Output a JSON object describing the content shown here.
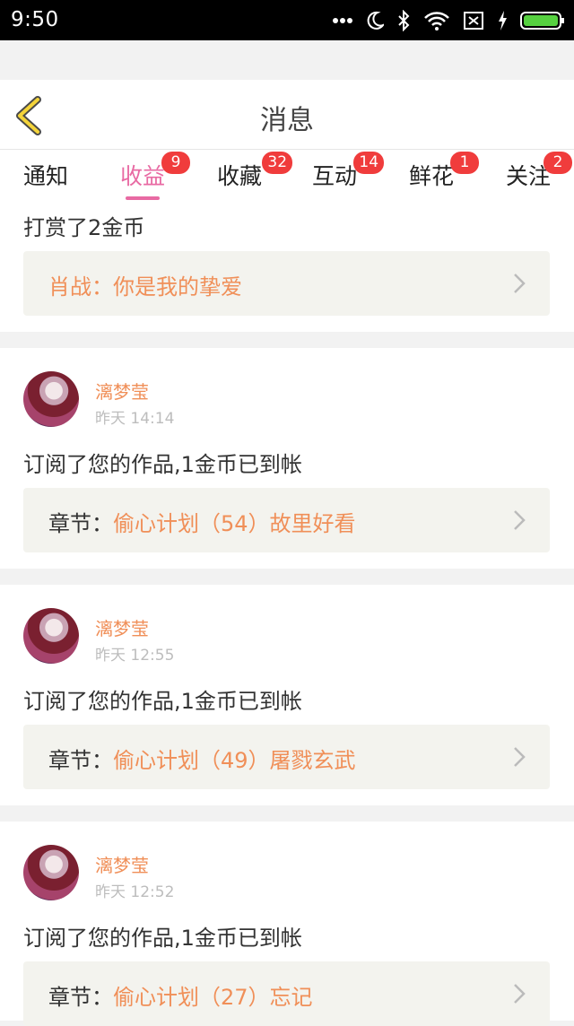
{
  "status_bar": {
    "time": "9:50"
  },
  "header": {
    "title": "消息"
  },
  "tabs": [
    {
      "label": "通知",
      "badge": ""
    },
    {
      "label": "收益",
      "badge": "9",
      "active": true
    },
    {
      "label": "收藏",
      "badge": "32"
    },
    {
      "label": "互动",
      "badge": "14"
    },
    {
      "label": "鲜花",
      "badge": "1"
    },
    {
      "label": "关注",
      "badge": "2"
    }
  ],
  "partial_item": {
    "text": "打赏了2金币",
    "link_label": "肖战：",
    "link_value": "你是我的挚爱"
  },
  "items": [
    {
      "user": "漓梦莹",
      "time": "昨天 14:14",
      "text": "订阅了您的作品,1金币已到帐",
      "link_label": "章节：",
      "link_value": "偷心计划（54）故里好看"
    },
    {
      "user": "漓梦莹",
      "time": "昨天 12:55",
      "text": "订阅了您的作品,1金币已到帐",
      "link_label": "章节：",
      "link_value": "偷心计划（49）屠戮玄武"
    },
    {
      "user": "漓梦莹",
      "time": "昨天 12:52",
      "text": "订阅了您的作品,1金币已到帐",
      "link_label": "章节：",
      "link_value": "偷心计划（27）忘记"
    }
  ],
  "colors": {
    "accent_pink": "#e86aa3",
    "accent_orange": "#f08f58",
    "badge_red": "#f03c3c"
  }
}
